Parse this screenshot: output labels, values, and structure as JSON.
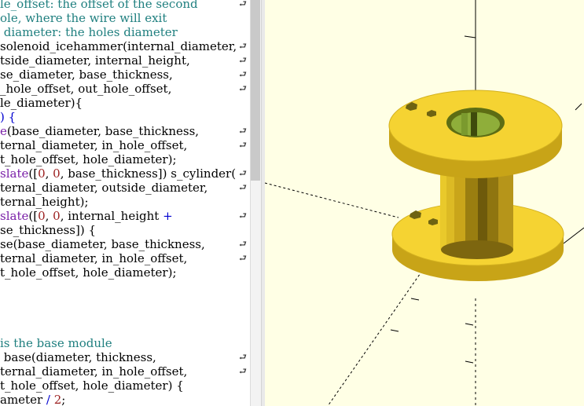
{
  "editor": {
    "lines": [
      {
        "segments": [
          {
            "t": "le_offset: the offset of the second",
            "c": "c"
          }
        ],
        "wrap": true
      },
      {
        "segments": [
          {
            "t": "ole, where the wire will exit",
            "c": "c"
          }
        ],
        "wrap": false
      },
      {
        "segments": [
          {
            "t": " diameter: the holes diameter",
            "c": "c"
          }
        ],
        "wrap": false
      },
      {
        "segments": [
          {
            "t": "solenoid_icehammer(internal_diameter,",
            "c": ""
          }
        ],
        "wrap": true
      },
      {
        "segments": [
          {
            "t": "tside_diameter, internal_height,",
            "c": ""
          }
        ],
        "wrap": true
      },
      {
        "segments": [
          {
            "t": "se_diameter, base_thickness,",
            "c": ""
          }
        ],
        "wrap": true
      },
      {
        "segments": [
          {
            "t": "_hole_offset, out_hole_offset,",
            "c": ""
          }
        ],
        "wrap": true
      },
      {
        "segments": [
          {
            "t": "le_diameter){",
            "c": ""
          }
        ],
        "wrap": false
      },
      {
        "segments": [
          {
            "t": ") {",
            "c": "k"
          }
        ],
        "wrap": false
      },
      {
        "segments": [
          {
            "t": "e",
            "c": "f"
          },
          {
            "t": "(base_diameter, base_thickness,",
            "c": ""
          }
        ],
        "wrap": true
      },
      {
        "segments": [
          {
            "t": "ternal_diameter, in_hole_offset,",
            "c": ""
          }
        ],
        "wrap": true
      },
      {
        "segments": [
          {
            "t": "t_hole_offset, hole_diameter);",
            "c": ""
          }
        ],
        "wrap": false
      },
      {
        "segments": [
          {
            "t": "slate",
            "c": "f"
          },
          {
            "t": "([",
            "c": ""
          },
          {
            "t": "0",
            "c": "n"
          },
          {
            "t": ", ",
            "c": ""
          },
          {
            "t": "0",
            "c": "n"
          },
          {
            "t": ", base_thickness]) s_cylinder(",
            "c": ""
          }
        ],
        "wrap": true
      },
      {
        "segments": [
          {
            "t": "ternal_diameter, outside_diameter,",
            "c": ""
          }
        ],
        "wrap": true
      },
      {
        "segments": [
          {
            "t": "ternal_height);",
            "c": ""
          }
        ],
        "wrap": false
      },
      {
        "segments": [
          {
            "t": "slate",
            "c": "f"
          },
          {
            "t": "([",
            "c": ""
          },
          {
            "t": "0",
            "c": "n"
          },
          {
            "t": ", ",
            "c": ""
          },
          {
            "t": "0",
            "c": "n"
          },
          {
            "t": ", internal_height ",
            "c": ""
          },
          {
            "t": "+",
            "c": "k"
          }
        ],
        "wrap": true
      },
      {
        "segments": [
          {
            "t": "se_thickness]) {",
            "c": ""
          }
        ],
        "wrap": false
      },
      {
        "segments": [
          {
            "t": "se(base_diameter, base_thickness,",
            "c": ""
          }
        ],
        "wrap": true
      },
      {
        "segments": [
          {
            "t": "ternal_diameter, in_hole_offset,",
            "c": ""
          }
        ],
        "wrap": true
      },
      {
        "segments": [
          {
            "t": "t_hole_offset, hole_diameter);",
            "c": ""
          }
        ],
        "wrap": false
      },
      {
        "segments": [],
        "wrap": false
      },
      {
        "segments": [],
        "wrap": false
      },
      {
        "segments": [],
        "wrap": false
      },
      {
        "segments": [],
        "wrap": false
      },
      {
        "segments": [
          {
            "t": "is the base module",
            "c": "c"
          }
        ],
        "wrap": false
      },
      {
        "segments": [
          {
            "t": " base(diameter, thickness,",
            "c": ""
          }
        ],
        "wrap": true
      },
      {
        "segments": [
          {
            "t": "ternal_diameter, in_hole_offset,",
            "c": ""
          }
        ],
        "wrap": true
      },
      {
        "segments": [
          {
            "t": "t_hole_offset, hole_diameter) {",
            "c": ""
          }
        ],
        "wrap": false
      },
      {
        "segments": [
          {
            "t": "ameter ",
            "c": ""
          },
          {
            "t": "/",
            "c": "k"
          },
          {
            "t": " ",
            "c": ""
          },
          {
            "t": "2",
            "c": "n"
          },
          {
            "t": ";",
            "c": ""
          }
        ],
        "wrap": false
      }
    ],
    "wrap_glyph": "⮐"
  },
  "viewport": {
    "background_color": "#ffffe5",
    "model_color": "#f5d332",
    "model_name": "solenoid spool"
  }
}
